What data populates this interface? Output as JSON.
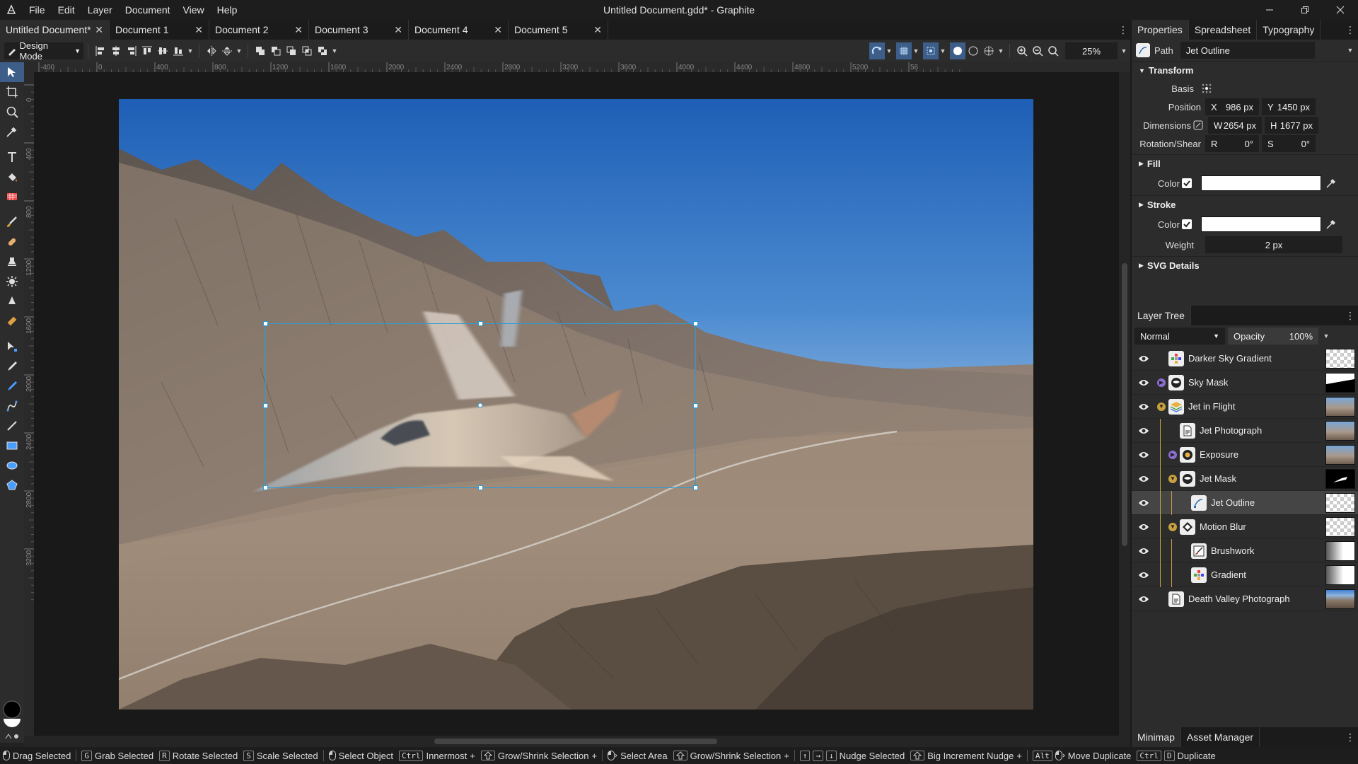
{
  "app": {
    "window_title": "Untitled Document.gdd* - Graphite"
  },
  "menu": {
    "items": [
      "File",
      "Edit",
      "Layer",
      "Document",
      "View",
      "Help"
    ]
  },
  "doc_tabs": [
    {
      "label": "Untitled Document*",
      "active": true
    },
    {
      "label": "Document 1"
    },
    {
      "label": "Document 2"
    },
    {
      "label": "Document 3"
    },
    {
      "label": "Document 4"
    },
    {
      "label": "Document 5"
    }
  ],
  "toolbar": {
    "mode": "Design Mode",
    "zoom": "25%"
  },
  "ruler_h": [
    "-400",
    "0",
    "400",
    "800",
    "1200",
    "1600",
    "2000",
    "2400",
    "2800",
    "3200",
    "3600",
    "4000",
    "4400",
    "4800",
    "5200",
    "56"
  ],
  "ruler_v": [
    "0",
    "400",
    "800",
    "1200",
    "1600",
    "2000",
    "2400",
    "2800",
    "3200"
  ],
  "panel_tabs": [
    "Properties",
    "Spreadsheet",
    "Typography"
  ],
  "properties": {
    "type": "Path",
    "name": "Jet Outline",
    "transform_title": "Transform",
    "basis_label": "Basis",
    "position_label": "Position",
    "x_label": "X",
    "x_value": "986 px",
    "y_label": "Y",
    "y_value": "1450 px",
    "dimensions_label": "Dimensions",
    "w_label": "W",
    "w_value": "2654 px",
    "h_label": "H",
    "h_value": "1677 px",
    "rotation_label": "Rotation/Shear",
    "r_label": "R",
    "r_value": "0°",
    "s_label": "S",
    "s_value": "0°",
    "fill_title": "Fill",
    "fill_color_label": "Color",
    "stroke_title": "Stroke",
    "stroke_color_label": "Color",
    "weight_label": "Weight",
    "weight_value": "2 px",
    "svg_title": "SVG Details"
  },
  "layer_tree": {
    "title": "Layer Tree",
    "blend_mode": "Normal",
    "opacity_label": "Opacity",
    "opacity_value": "100%",
    "layers": [
      {
        "name": "Darker Sky Gradient",
        "icon": "gradient-icon",
        "depth": 0
      },
      {
        "name": "Sky Mask",
        "icon": "mask-icon",
        "depth": 0,
        "collapsed": true
      },
      {
        "name": "Jet in Flight",
        "icon": "folder-icon",
        "depth": 0,
        "expanded": true
      },
      {
        "name": "Jet Photograph",
        "icon": "image-icon",
        "depth": 1
      },
      {
        "name": "Exposure",
        "icon": "exposure-icon",
        "depth": 1,
        "collapsed": true
      },
      {
        "name": "Jet Mask",
        "icon": "mask-icon",
        "depth": 1,
        "expanded": true
      },
      {
        "name": "Jet Outline",
        "icon": "path-icon",
        "depth": 2,
        "selected": true
      },
      {
        "name": "Motion Blur",
        "icon": "blur-icon",
        "depth": 1,
        "expanded": true
      },
      {
        "name": "Brushwork",
        "icon": "brush-icon",
        "depth": 2
      },
      {
        "name": "Gradient",
        "icon": "gradient-icon",
        "depth": 2
      },
      {
        "name": "Death Valley Photograph",
        "icon": "image-icon",
        "depth": 0
      }
    ]
  },
  "bottom_tabs": [
    "Minimap",
    "Asset Manager"
  ],
  "status": [
    {
      "keys": [
        "mouse-left"
      ],
      "label": "Drag Selected"
    },
    {
      "keys": [
        "G"
      ],
      "label": "Grab Selected"
    },
    {
      "keys": [
        "R"
      ],
      "label": "Rotate Selected"
    },
    {
      "keys": [
        "S"
      ],
      "label": "Scale Selected"
    },
    {
      "keys": [
        "mouse-left"
      ],
      "label": "Select Object"
    },
    {
      "keys": [
        "Ctrl"
      ],
      "label": "Innermost",
      "plus": true
    },
    {
      "keys": [
        "shift"
      ],
      "label": "Grow/Shrink Selection",
      "plus": true
    },
    {
      "keys": [
        "mouse-drag"
      ],
      "label": "Select Area"
    },
    {
      "keys": [
        "shift"
      ],
      "label": "Grow/Shrink Selection",
      "plus": true
    },
    {
      "keys": [
        "↑",
        "→",
        "↓"
      ],
      "label": "Nudge Selected"
    },
    {
      "keys": [
        "shift"
      ],
      "label": "Big Increment Nudge",
      "plus": true
    },
    {
      "keys": [
        "Alt",
        "mouse-drag"
      ],
      "label": "Move Duplicate"
    },
    {
      "keys": [
        "Ctrl",
        "D"
      ],
      "label": "Duplicate"
    }
  ],
  "colors": {
    "accent": "#4a9eff",
    "selection": "#2e9bd6",
    "active_tool": "#3e5e8a"
  }
}
